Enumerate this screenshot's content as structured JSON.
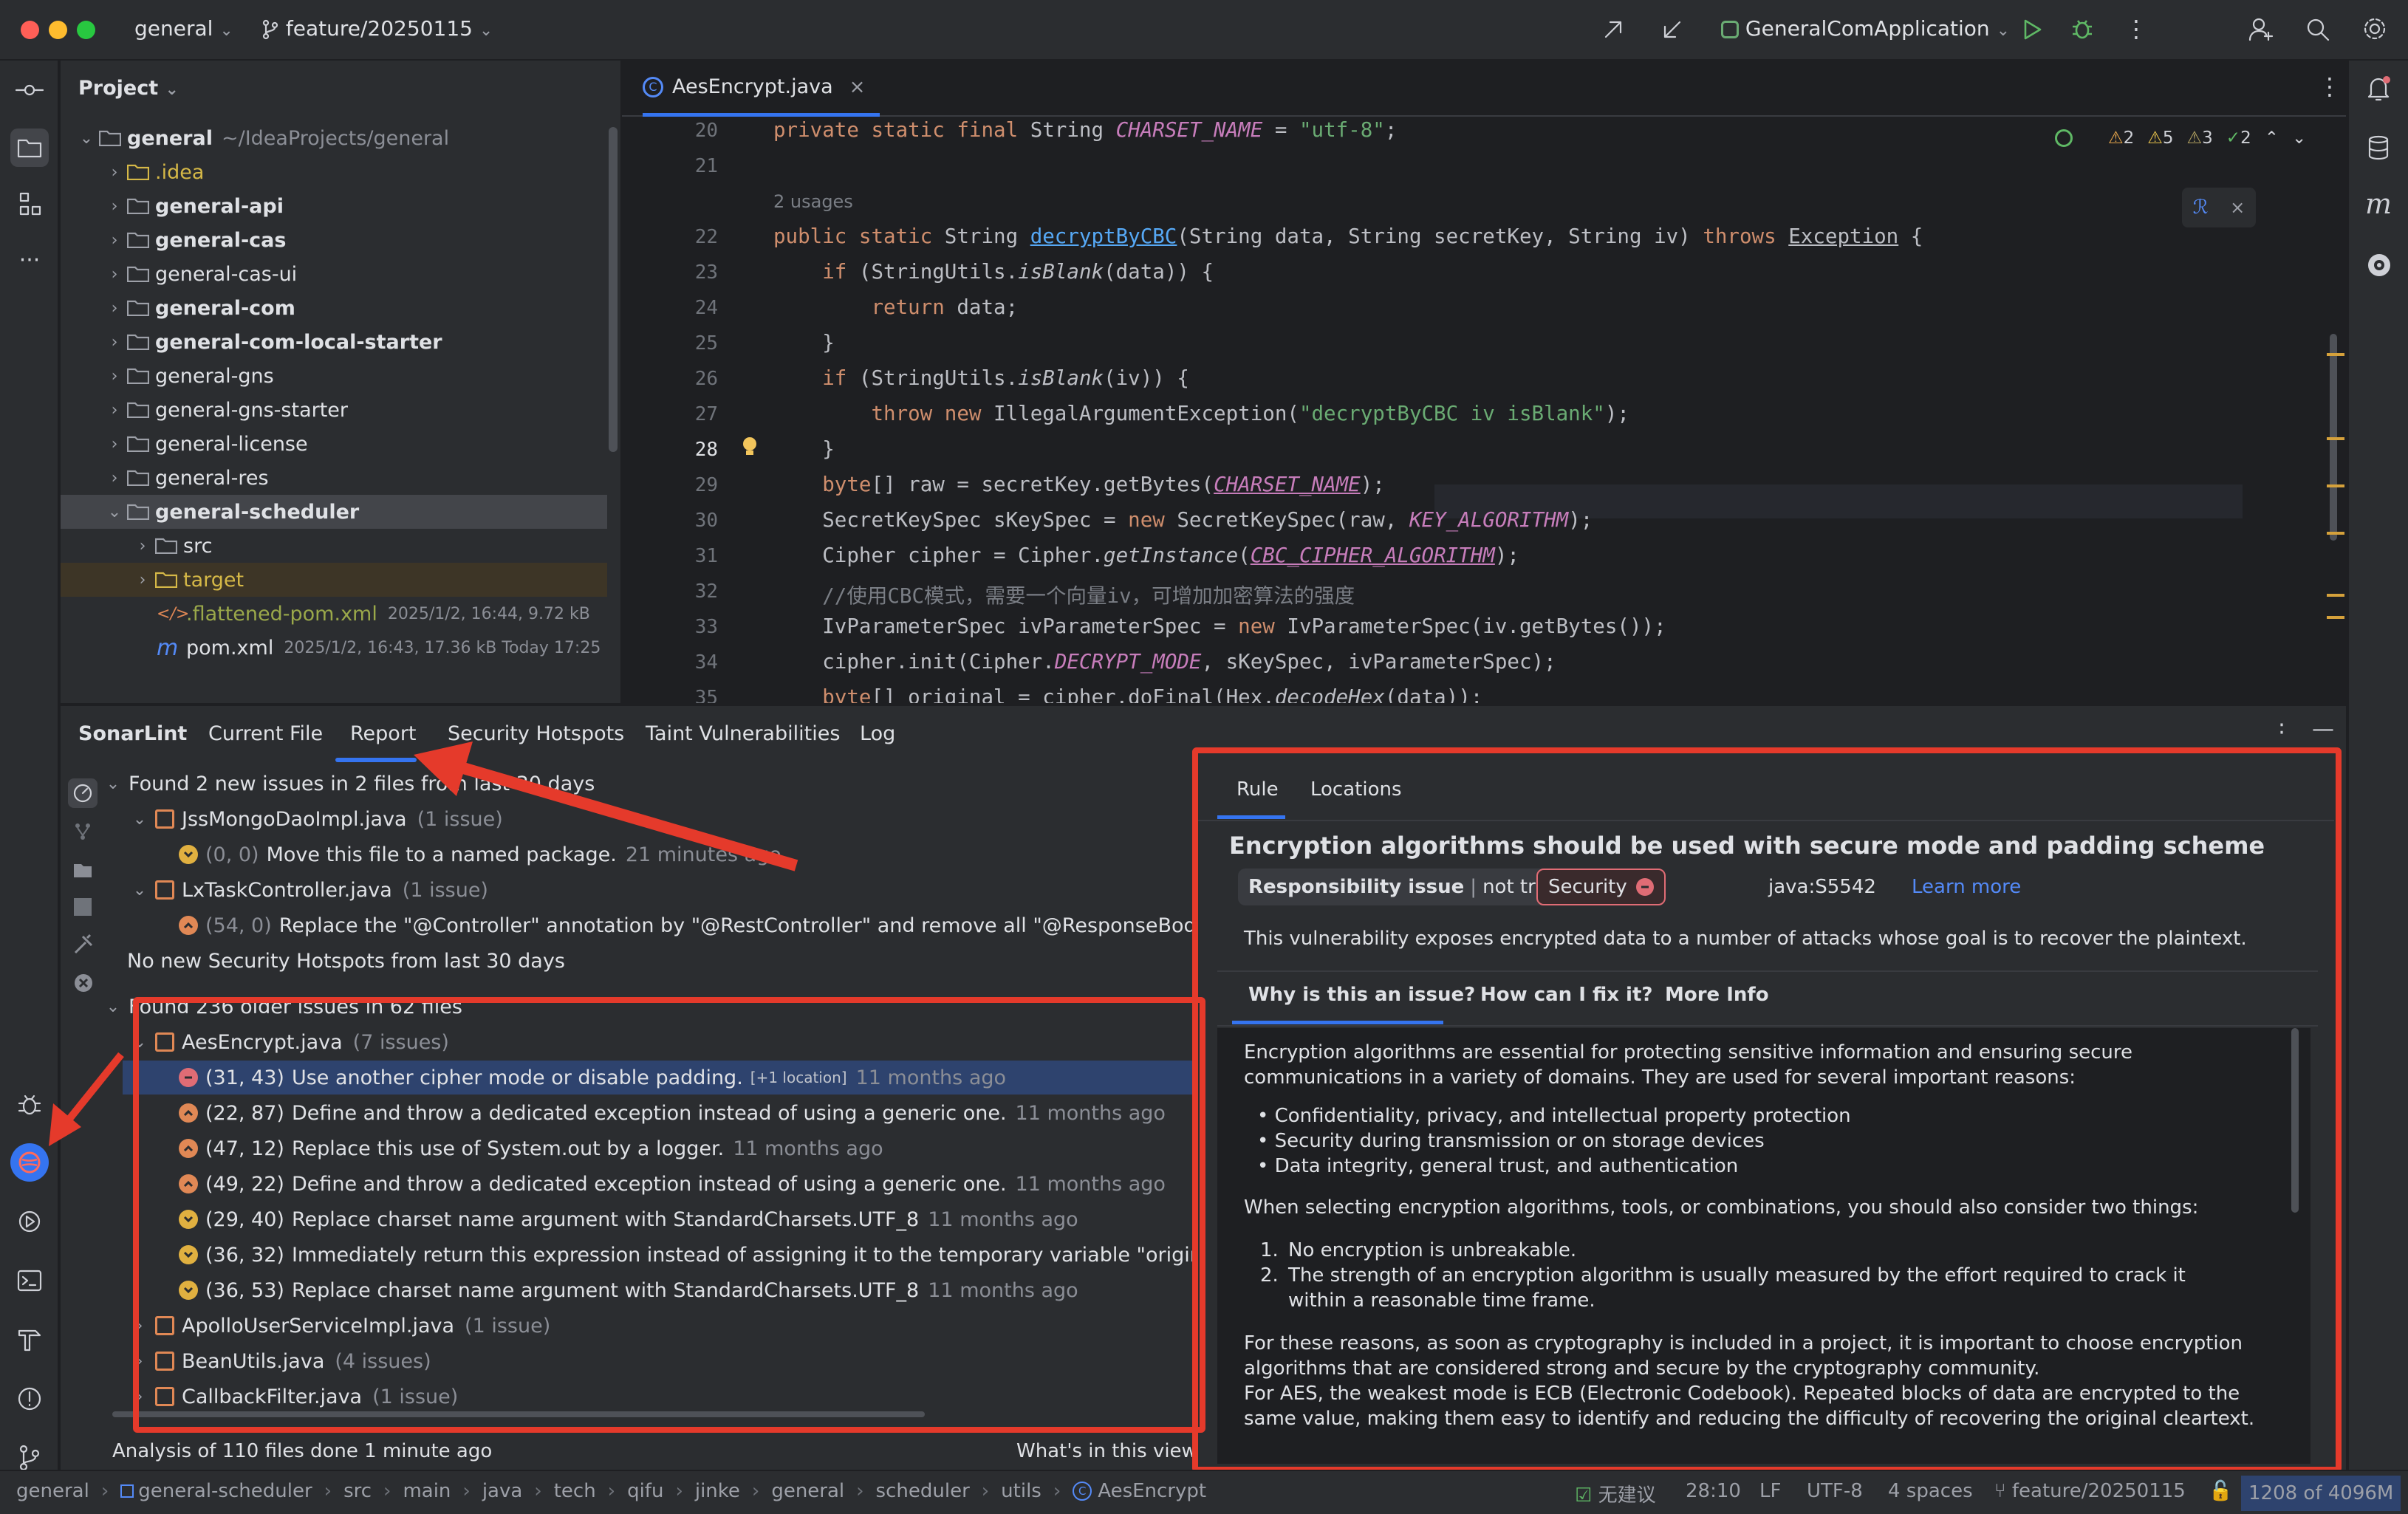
{
  "titlebar": {
    "project": "general",
    "branch": "feature/20250115",
    "run_config": "GeneralComApplication"
  },
  "project_panel": {
    "title": "Project",
    "tree": [
      {
        "label": "general",
        "path": "~/IdeaProjects/general",
        "bold": true,
        "expanded": true,
        "indent": 0
      },
      {
        "label": ".idea",
        "color": "#d5b847",
        "indent": 1
      },
      {
        "label": "general-api",
        "bold": true,
        "indent": 1
      },
      {
        "label": "general-cas",
        "bold": true,
        "indent": 1
      },
      {
        "label": "general-cas-ui",
        "indent": 1
      },
      {
        "label": "general-com",
        "bold": true,
        "indent": 1
      },
      {
        "label": "general-com-local-starter",
        "bold": true,
        "indent": 1
      },
      {
        "label": "general-gns",
        "indent": 1
      },
      {
        "label": "general-gns-starter",
        "indent": 1
      },
      {
        "label": "general-license",
        "indent": 1
      },
      {
        "label": "general-res",
        "indent": 1
      },
      {
        "label": "general-scheduler",
        "bold": true,
        "expanded": true,
        "selected": true,
        "indent": 1
      },
      {
        "label": "src",
        "indent": 2
      },
      {
        "label": "target",
        "color": "#d5b847",
        "highlight": true,
        "indent": 2
      },
      {
        "label": ".flattened-pom.xml",
        "meta": "2025/1/2, 16:44, 9.72 kB",
        "color": "#9aa84a",
        "indent": 2,
        "file": "xml"
      },
      {
        "label": "pom.xml",
        "meta": "2025/1/2, 16:43, 17.36 kB Today 17:25",
        "indent": 2,
        "file": "maven"
      }
    ]
  },
  "editor": {
    "tab": "AesEncrypt.java",
    "inspections": {
      "errors": "2",
      "warnings": "5",
      "weak": "3",
      "ok": "2"
    },
    "usages_hint": "2 usages",
    "current_line": "28"
  },
  "sonarlint": {
    "tabs": [
      "SonarLint",
      "Current File",
      "Report",
      "Security Hotspots",
      "Taint Vulnerabilities",
      "Log"
    ],
    "new_issues_header": "Found 2 new issues in 2 files from last 30 days",
    "new_files": [
      {
        "name": "JssMongoDaoImpl.java",
        "count": "(1 issue)"
      },
      {
        "name": "LxTaskController.java",
        "count": "(1 issue)"
      }
    ],
    "new_issues": [
      {
        "loc": "(0, 0)",
        "msg": "Move this file to a named package.",
        "age": "21 minutes ago",
        "sev": "n",
        "muted": true
      },
      {
        "loc": "(54, 0)",
        "msg": "Replace the \"@Controller\" annotation by \"@RestController\" and remove all \"@ResponseBody\"",
        "age": "",
        "sev": "m",
        "muted": true
      }
    ],
    "no_hotspots": "No new Security Hotspots from last 30 days",
    "older_header": "Found 236 older issues in 62 files",
    "older_file": {
      "name": "AesEncrypt.java",
      "count": "(7 issues)"
    },
    "older_issues": [
      {
        "loc": "(31, 43)",
        "msg": "Use another cipher mode or disable padding.",
        "extra": "[+1 location]",
        "age": "11 months ago",
        "sev": "b",
        "selected": true
      },
      {
        "loc": "(22, 87)",
        "msg": "Define and throw a dedicated exception instead of using a generic one.",
        "age": "11 months ago",
        "sev": "m"
      },
      {
        "loc": "(47, 12)",
        "msg": "Replace this use of System.out by a logger.",
        "age": "11 months ago",
        "sev": "m"
      },
      {
        "loc": "(49, 22)",
        "msg": "Define and throw a dedicated exception instead of using a generic one.",
        "age": "11 months ago",
        "sev": "m"
      },
      {
        "loc": "(29, 40)",
        "msg": "Replace charset name argument with StandardCharsets.UTF_8",
        "age": "11 months ago",
        "sev": "n"
      },
      {
        "loc": "(36, 32)",
        "msg": "Immediately return this expression instead of assigning it to the temporary variable \"originalS",
        "age": "",
        "sev": "n"
      },
      {
        "loc": "(36, 53)",
        "msg": "Replace charset name argument with StandardCharsets.UTF_8",
        "age": "11 months ago",
        "sev": "n"
      }
    ],
    "other_files": [
      {
        "name": "ApolloUserServiceImpl.java",
        "count": "(1 issue)"
      },
      {
        "name": "BeanUtils.java",
        "count": "(4 issues)"
      },
      {
        "name": "CallbackFilter.java",
        "count": "(1 issue)"
      }
    ],
    "footer_analysis": "Analysis of 110 files done 1 minute ago",
    "footer_link": "What's in this view"
  },
  "rule": {
    "tabs": [
      "Rule",
      "Locations"
    ],
    "title": "Encryption algorithms should be used with secure mode and padding scheme",
    "badge_left": "Responsibility issue",
    "badge_right": "not trustworthy",
    "security": "Security",
    "key": "java:S5542",
    "learn_more": "Learn more",
    "summary": "This vulnerability exposes encrypted data to a number of attacks whose goal is to recover the plaintext.",
    "subtabs": [
      "Why is this an issue?",
      "How can I fix it?",
      "More Info"
    ],
    "p1": "Encryption algorithms are essential for protecting sensitive information and ensuring secure communications in a variety of domains. They are used for several important reasons:",
    "bullets": [
      "Confidentiality, privacy, and intellectual property protection",
      "Security during transmission or on storage devices",
      "Data integrity, general trust, and authentication"
    ],
    "p2": "When selecting encryption algorithms, tools, or combinations, you should also consider two things:",
    "numbered": [
      "No encryption is unbreakable.",
      "The strength of an encryption algorithm is usually measured by the effort required to crack it within a reasonable time frame."
    ],
    "p3": "For these reasons, as soon as cryptography is included in a project, it is important to choose encryption algorithms that are considered strong and secure by the cryptography community.",
    "p4": "For AES, the weakest mode is ECB (Electronic Codebook). Repeated blocks of data are encrypted to the same value, making them easy to identify and reducing the difficulty of recovering the original cleartext."
  },
  "statusbar": {
    "breadcrumb": [
      "general",
      "general-scheduler",
      "src",
      "main",
      "java",
      "tech",
      "qifu",
      "jinke",
      "general",
      "scheduler",
      "utils",
      "AesEncrypt"
    ],
    "suggestion": "无建议",
    "position": "28:10",
    "line_sep": "LF",
    "encoding": "UTF-8",
    "indent": "4 spaces",
    "branch": "feature/20250115",
    "memory": "1208 of 4096M"
  }
}
